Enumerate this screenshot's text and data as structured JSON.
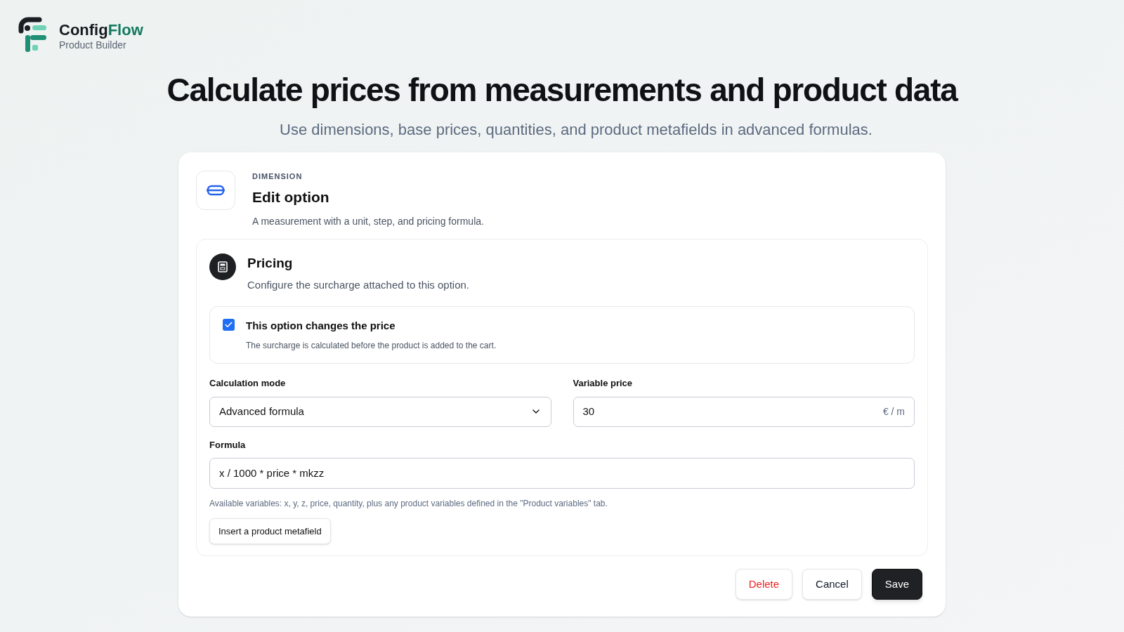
{
  "brand": {
    "name_start": "Config",
    "name_end": "Flow",
    "tagline": "Product Builder"
  },
  "hero": {
    "title": "Calculate prices from measurements and product data",
    "subtitle": "Use dimensions, base prices, quantities, and product metafields in advanced formulas."
  },
  "editor": {
    "eyebrow": "DIMENSION",
    "title": "Edit option",
    "description": "A measurement with a unit, step, and pricing formula.",
    "section": {
      "title": "Pricing",
      "description": "Configure the surcharge attached to this option.",
      "toggle": {
        "label": "This option changes the price",
        "hint": "The surcharge is calculated before the product is added to the cart.",
        "checked": true
      },
      "calculation_mode": {
        "label": "Calculation mode",
        "value": "Advanced formula"
      },
      "variable_price": {
        "label": "Variable price",
        "value": "30",
        "unit": "€ / m"
      },
      "formula": {
        "label": "Formula",
        "value": "x / 1000 * price * mkzz",
        "help": "Available variables: x, y, z, price, quantity, plus any product variables defined in the \"Product variables\" tab."
      },
      "metafield_button": "Insert a product metafield"
    },
    "actions": [
      {
        "label": "Delete",
        "kind": "danger"
      },
      {
        "label": "Cancel",
        "kind": "default"
      },
      {
        "label": "Save",
        "kind": "primary"
      }
    ]
  }
}
